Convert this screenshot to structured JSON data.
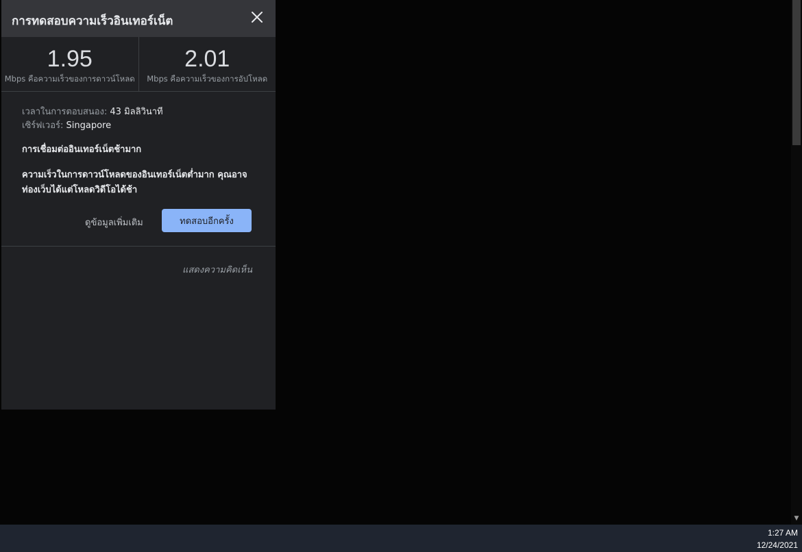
{
  "panel": {
    "title": "การทดสอบความเร็วอินเทอร์เน็ต",
    "download": {
      "value": "1.95",
      "caption": "Mbps คือความเร็วของการดาวน์โหลด"
    },
    "upload": {
      "value": "2.01",
      "caption": "Mbps คือความเร็วของการอัปโหลด"
    },
    "latency": {
      "label": "เวลาในการตอบสนอง: ",
      "value": "43 มิลลิวินาที"
    },
    "server": {
      "label": "เซิร์ฟเวอร์: ",
      "value": "Singapore"
    },
    "status": "การเชื่อมต่ออินเทอร์เน็ตช้ามาก",
    "description": "ความเร็วในการดาวน์โหลดของอินเทอร์เน็ตต่ำมาก คุณอาจท่องเว็บได้แต่โหลดวิดีโอได้ช้า",
    "more_info_label": "ดูข้อมูลเพิ่มเติม",
    "retry_label": "ทดสอบอีกครั้ง",
    "feedback_label": "แสดงความคิดเห็น",
    "close_icon": "close-icon"
  },
  "taskbar": {
    "time": "1:27 AM",
    "date": "12/24/2021"
  },
  "colors": {
    "panel_bg": "#202124",
    "header_bg": "#35363a",
    "accent": "#8ab4f8",
    "taskbar_bg": "#1f2530"
  }
}
